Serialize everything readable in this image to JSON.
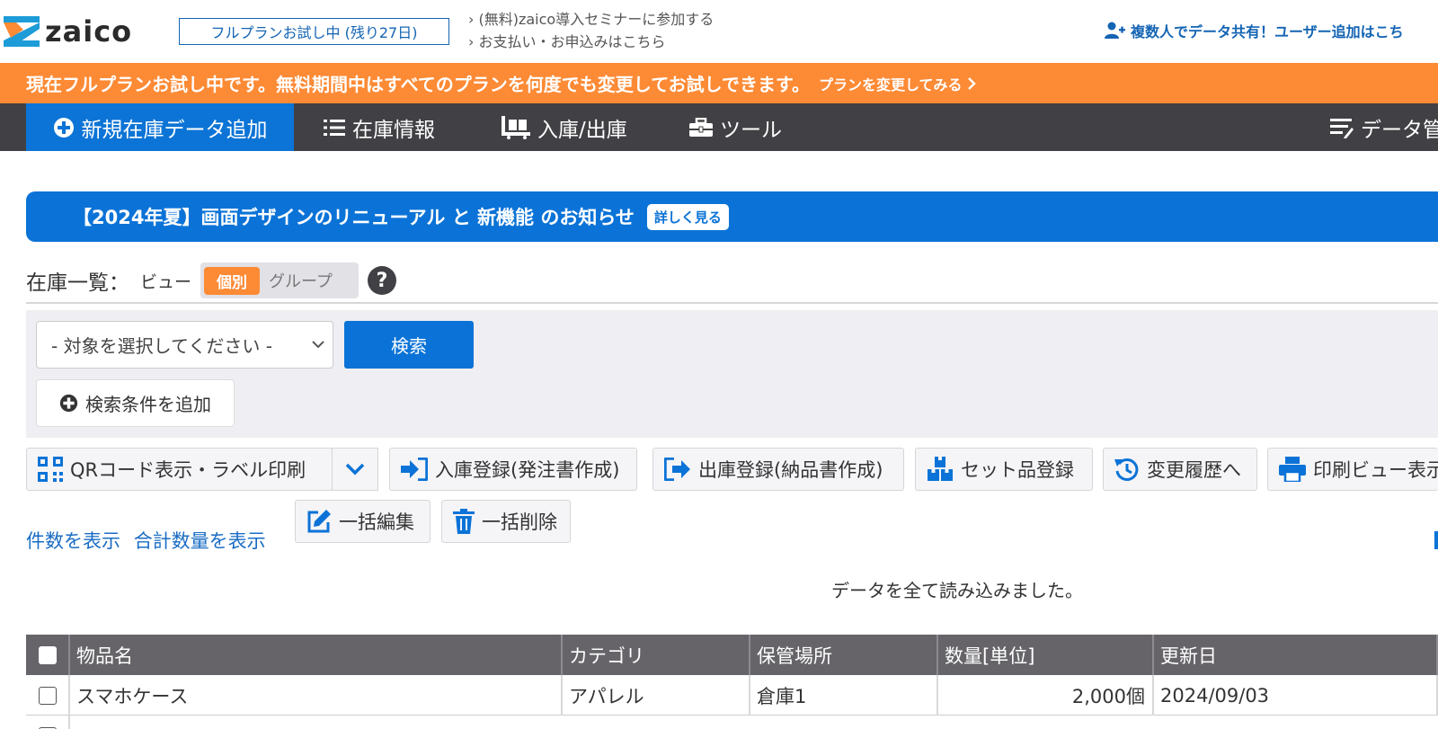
{
  "header": {
    "logo_text": "zaico",
    "trial_badge": "フルプランお試し中 (残り27日)",
    "links": [
      "› (無料)zaico導入セミナーに参加する",
      "› お支払い・お申込みはこちら"
    ],
    "share_link": "複数人でデータ共有！ユーザー追加はこち",
    "logo_colors": {
      "primary": "#1d9cd8",
      "accent": "#fd8a35"
    }
  },
  "banner": {
    "message": "現在フルプランお試し中です。無料期間中はすべてのプランを何度でも変更してお試しできます。",
    "cta": "プランを変更してみる"
  },
  "nav": {
    "items": [
      {
        "label": "新規在庫データ追加",
        "icon": "plus-circle-icon"
      },
      {
        "label": "在庫情報",
        "icon": "list-icon"
      },
      {
        "label": "入庫/出庫",
        "icon": "dolly-icon"
      },
      {
        "label": "ツール",
        "icon": "toolbox-icon"
      },
      {
        "label": "データ管",
        "icon": "data-list-icon"
      }
    ]
  },
  "announcement": {
    "title": "【2024年夏】画面デザインのリニューアル と 新機能 のお知らせ",
    "more": "詳しく見る"
  },
  "list": {
    "heading": "在庫一覧：",
    "view_label": "ビュー",
    "view_options": [
      "個別",
      "グループ"
    ],
    "help": "?"
  },
  "search": {
    "select_value": "- 対象を選択してください -",
    "search_button": "検索",
    "add_condition": "検索条件を追加"
  },
  "toolbar": {
    "qr": "QRコード表示・ラベル印刷",
    "receive": "入庫登録(発注書作成)",
    "ship": "出庫登録(納品書作成)",
    "set": "セット品登録",
    "history": "変更履歴へ",
    "print": "印刷ビュー表示",
    "bulk_edit": "一括編集",
    "bulk_delete": "一括削除"
  },
  "counts": {
    "show_count": "件数を表示",
    "show_total": "合計数量を表示",
    "loaded": "データを全て読み込みました。"
  },
  "table": {
    "headers": [
      "物品名",
      "カテゴリ",
      "保管場所",
      "数量[単位]",
      "更新日"
    ],
    "rows": [
      {
        "name": "スマホケース",
        "category": "アパレル",
        "location": "倉庫1",
        "qty": "2,000個",
        "date": "2024/09/03"
      }
    ]
  },
  "colors": {
    "brand_blue": "#0b73d7",
    "orange": "#fd8a35",
    "nav_dark": "#414044",
    "table_header": "#666469"
  }
}
